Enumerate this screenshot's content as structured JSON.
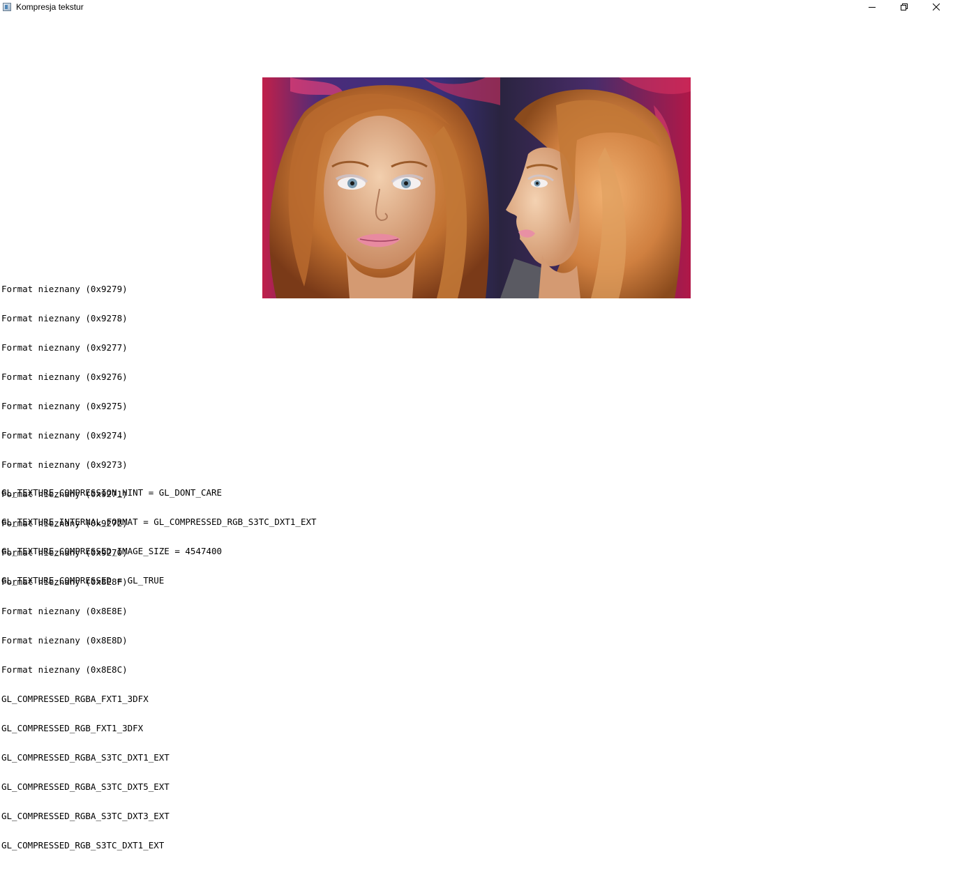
{
  "window": {
    "title": "Kompresja tekstur",
    "controls": {
      "minimize": "minimize-icon",
      "maximize": "restore-icon",
      "close": "close-icon"
    }
  },
  "formats": [
    "Format nieznany (0x9279)",
    "Format nieznany (0x9278)",
    "Format nieznany (0x9277)",
    "Format nieznany (0x9276)",
    "Format nieznany (0x9275)",
    "Format nieznany (0x9274)",
    "Format nieznany (0x9273)",
    "Format nieznany (0x9271)",
    "Format nieznany (0x9272)",
    "Format nieznany (0x9270)",
    "Format nieznany (0x8E8F)",
    "Format nieznany (0x8E8E)",
    "Format nieznany (0x8E8D)",
    "Format nieznany (0x8E8C)",
    "GL_COMPRESSED_RGBA_FXT1_3DFX",
    "GL_COMPRESSED_RGB_FXT1_3DFX",
    "GL_COMPRESSED_RGBA_S3TC_DXT1_EXT",
    "GL_COMPRESSED_RGBA_S3TC_DXT5_EXT",
    "GL_COMPRESSED_RGBA_S3TC_DXT3_EXT",
    "GL_COMPRESSED_RGB_S3TC_DXT1_EXT"
  ],
  "parameters": [
    "GL_TEXTURE_COMPRESSION_HINT = GL_DONT_CARE",
    "GL_TEXTURE_INTERNAL_FORMAT = GL_COMPRESSED_RGB_S3TC_DXT1_EXT",
    "GL_TEXTURE_COMPRESSED_IMAGE_SIZE = 4547400",
    "GL_TEXTURE_COMPRESSED = GL_TRUE"
  ],
  "colors": {
    "background": "#ffffff",
    "text": "#000000",
    "backdrop_purple": "#3a2f7a",
    "backdrop_magenta": "#c0204a",
    "hair": "#c87a3a",
    "skin": "#e6b08a"
  },
  "texture": {
    "description_icon": "textured-quad-photo"
  }
}
